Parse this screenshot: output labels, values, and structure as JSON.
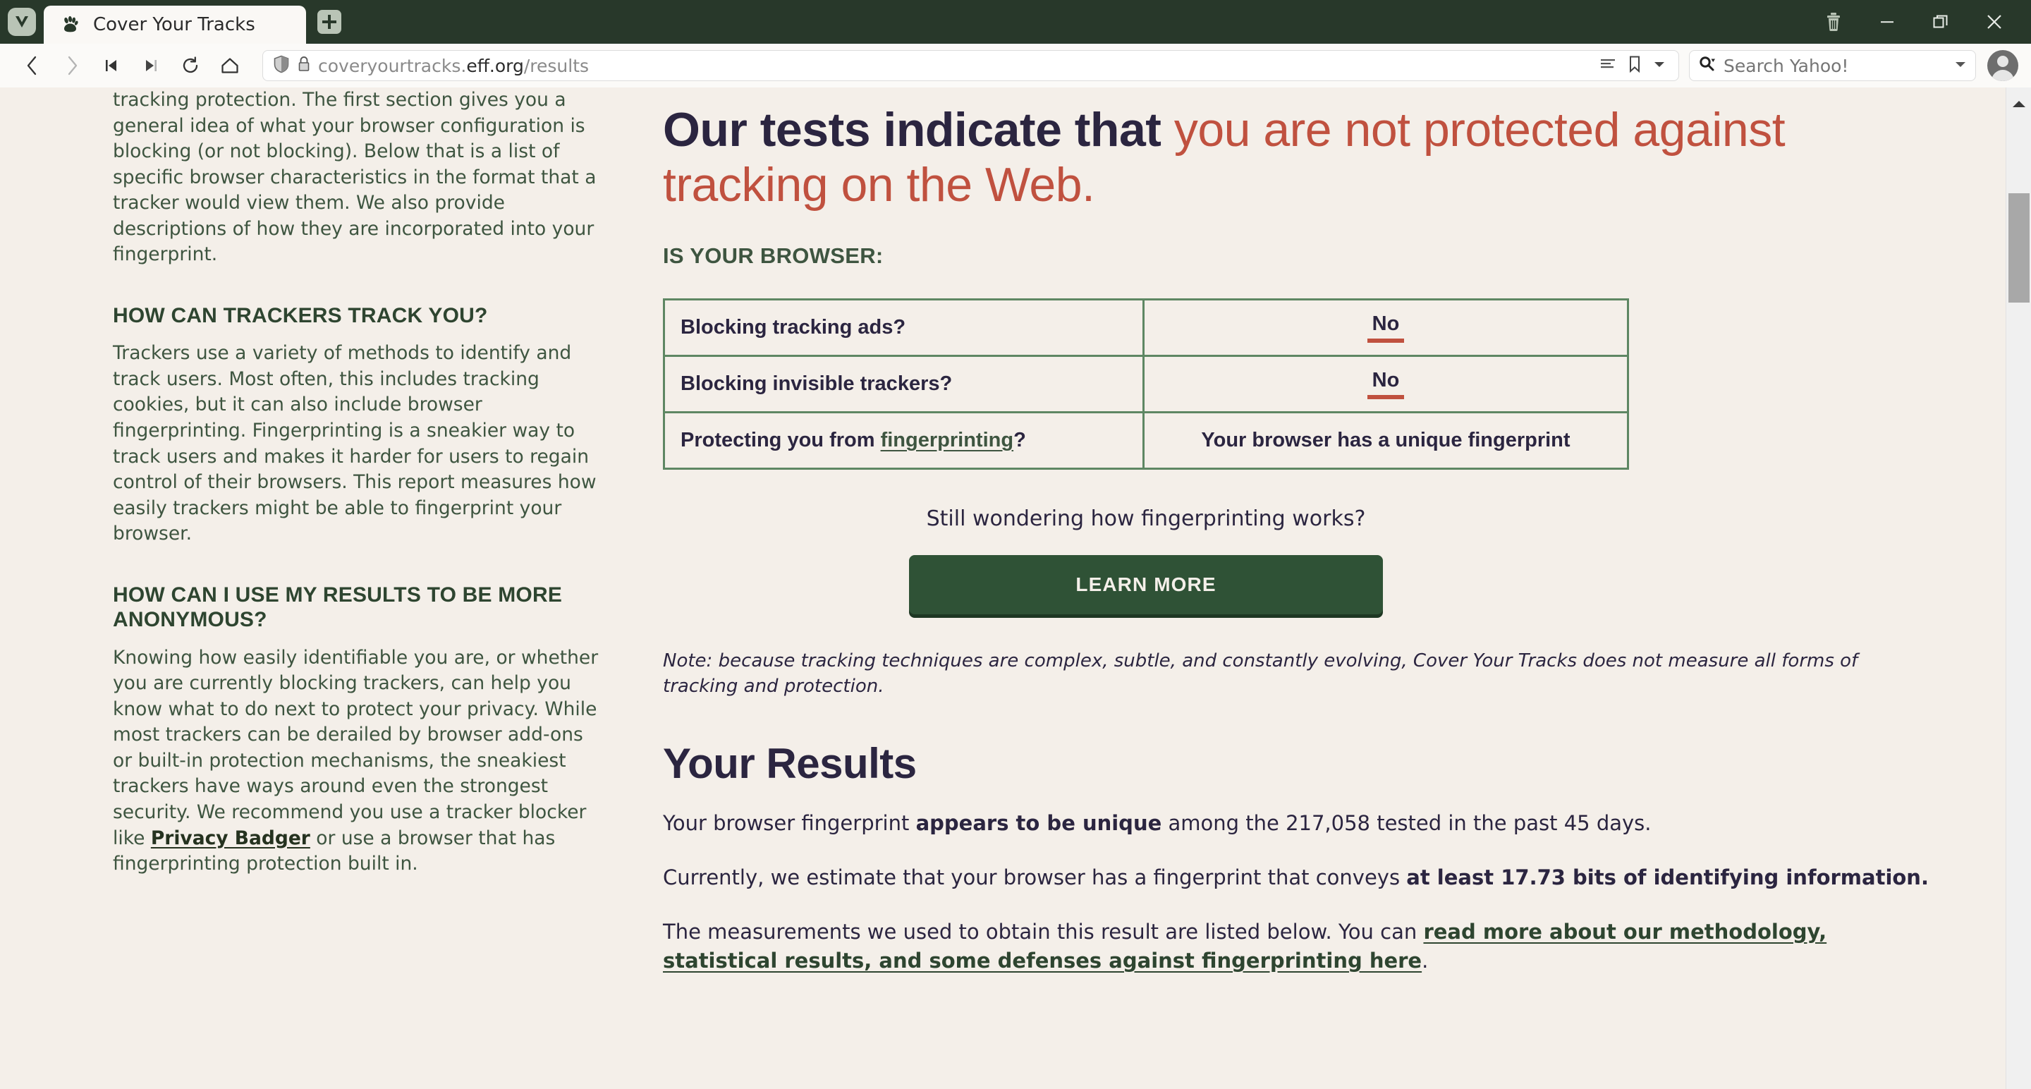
{
  "browser": {
    "app_logo": "vivaldi-logo",
    "tab": {
      "favicon": "paw-print-icon",
      "title": "Cover Your Tracks"
    },
    "new_tab_label": "+",
    "window_controls": [
      {
        "name": "trash-icon",
        "label": "Trash"
      },
      {
        "name": "minimize-icon",
        "label": "Minimize"
      },
      {
        "name": "maximize-icon",
        "label": "Restore"
      },
      {
        "name": "close-icon",
        "label": "Close"
      }
    ],
    "nav": [
      {
        "name": "back-icon",
        "label": "Back"
      },
      {
        "name": "forward-icon",
        "label": "Forward"
      },
      {
        "name": "rewind-icon",
        "label": "Rewind"
      },
      {
        "name": "fastforward-icon",
        "label": "Fast Forward"
      },
      {
        "name": "reload-icon",
        "label": "Reload"
      },
      {
        "name": "home-icon",
        "label": "Home"
      }
    ],
    "address": {
      "shield_icon": "shield-icon",
      "lock_icon": "lock-icon",
      "url_prefix": "coveryourtracks.",
      "url_domain": "eff.org",
      "url_suffix": "/results",
      "reader_icon": "reader-list-icon",
      "bookmark_icon": "bookmark-icon",
      "dropdown_icon": "chevron-down-icon"
    },
    "search": {
      "engine_icon": "search-magnifier-icon",
      "placeholder": "Search Yahoo!",
      "dropdown_icon": "chevron-down-icon"
    },
    "profile_icon": "user-avatar-icon"
  },
  "sidebar": {
    "intro_paragraph": "tracking protection. The first section gives you a general idea of what your browser configuration is blocking (or not blocking). Below that is a list of specific browser characteristics in the format that a tracker would view them. We also provide descriptions of how they are incorporated into your fingerprint.",
    "sections": [
      {
        "heading": "HOW CAN TRACKERS TRACK YOU?",
        "body": "Trackers use a variety of methods to identify and track users. Most often, this includes tracking cookies, but it can also include browser fingerprinting. Fingerprinting is a sneakier way to track users and makes it harder for users to regain control of their browsers. This report measures how easily trackers might be able to fingerprint your browser."
      },
      {
        "heading": "HOW CAN I USE MY RESULTS TO BE MORE ANONYMOUS?",
        "body_1": "Knowing how easily identifiable you are, or whether you are currently blocking trackers, can help you know what to do next to protect your privacy. While most trackers can be derailed by browser add-ons or built-in protection mechanisms, the sneakiest trackers have ways around even the strongest security. We recommend you use a tracker blocker like ",
        "link_text": "Privacy Badger",
        "body_2": " or use a browser that has fingerprinting protection built in."
      }
    ]
  },
  "main": {
    "verdict_lead": "Our tests indicate that ",
    "verdict_danger": "you are not protected against tracking on the Web.",
    "subheading": "IS YOUR BROWSER:",
    "table": {
      "rows": [
        {
          "question": "Blocking tracking ads?",
          "answer": "No",
          "answer_type": "negative"
        },
        {
          "question": "Blocking invisible trackers?",
          "answer": "No",
          "answer_type": "negative"
        },
        {
          "question_prefix": "Protecting you from ",
          "question_link": "fingerprinting",
          "question_suffix": "?",
          "answer": "Your browser has a unique fingerprint",
          "answer_type": "text"
        }
      ]
    },
    "wondering_text": "Still wondering how fingerprinting works?",
    "learn_more_label": "LEARN MORE",
    "note": "Note: because tracking techniques are complex, subtle, and constantly evolving, Cover Your Tracks does not measure all forms of tracking and protection.",
    "results_title": "Your Results",
    "para_1": {
      "a": "Your browser fingerprint ",
      "bold": "appears to be unique",
      "b": " among the 217,058 tested in the past 45 days.",
      "tested_count": "217,058",
      "days": "45"
    },
    "para_2": {
      "a": "Currently, we estimate that your browser has a fingerprint that conveys ",
      "bold": "at least 17.73 bits of identifying information.",
      "bits": "17.73"
    },
    "para_3": {
      "a": "The measurements we used to obtain this result are listed below. You can ",
      "link": "read more about our methodology, statistical results, and some defenses against fingerprinting here",
      "b": "."
    }
  },
  "colors": {
    "chrome_green": "#28382a",
    "page_bg": "#f4efe9",
    "navy_text": "#2b2540",
    "danger_red": "#c0513f",
    "brand_green": "#3e5540",
    "table_border": "#5e8763",
    "button_green": "#2f5236"
  }
}
